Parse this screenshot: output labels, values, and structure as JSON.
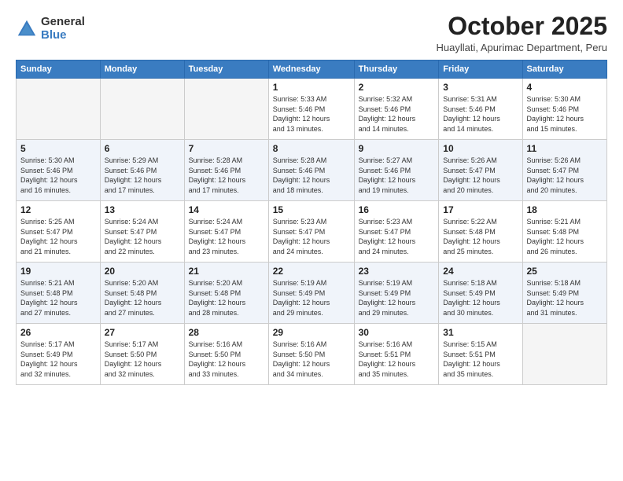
{
  "logo": {
    "general": "General",
    "blue": "Blue"
  },
  "header": {
    "month": "October 2025",
    "location": "Huayllati, Apurimac Department, Peru"
  },
  "weekdays": [
    "Sunday",
    "Monday",
    "Tuesday",
    "Wednesday",
    "Thursday",
    "Friday",
    "Saturday"
  ],
  "weeks": [
    [
      {
        "day": "",
        "info": ""
      },
      {
        "day": "",
        "info": ""
      },
      {
        "day": "",
        "info": ""
      },
      {
        "day": "1",
        "info": "Sunrise: 5:33 AM\nSunset: 5:46 PM\nDaylight: 12 hours\nand 13 minutes."
      },
      {
        "day": "2",
        "info": "Sunrise: 5:32 AM\nSunset: 5:46 PM\nDaylight: 12 hours\nand 14 minutes."
      },
      {
        "day": "3",
        "info": "Sunrise: 5:31 AM\nSunset: 5:46 PM\nDaylight: 12 hours\nand 14 minutes."
      },
      {
        "day": "4",
        "info": "Sunrise: 5:30 AM\nSunset: 5:46 PM\nDaylight: 12 hours\nand 15 minutes."
      }
    ],
    [
      {
        "day": "5",
        "info": "Sunrise: 5:30 AM\nSunset: 5:46 PM\nDaylight: 12 hours\nand 16 minutes."
      },
      {
        "day": "6",
        "info": "Sunrise: 5:29 AM\nSunset: 5:46 PM\nDaylight: 12 hours\nand 17 minutes."
      },
      {
        "day": "7",
        "info": "Sunrise: 5:28 AM\nSunset: 5:46 PM\nDaylight: 12 hours\nand 17 minutes."
      },
      {
        "day": "8",
        "info": "Sunrise: 5:28 AM\nSunset: 5:46 PM\nDaylight: 12 hours\nand 18 minutes."
      },
      {
        "day": "9",
        "info": "Sunrise: 5:27 AM\nSunset: 5:46 PM\nDaylight: 12 hours\nand 19 minutes."
      },
      {
        "day": "10",
        "info": "Sunrise: 5:26 AM\nSunset: 5:47 PM\nDaylight: 12 hours\nand 20 minutes."
      },
      {
        "day": "11",
        "info": "Sunrise: 5:26 AM\nSunset: 5:47 PM\nDaylight: 12 hours\nand 20 minutes."
      }
    ],
    [
      {
        "day": "12",
        "info": "Sunrise: 5:25 AM\nSunset: 5:47 PM\nDaylight: 12 hours\nand 21 minutes."
      },
      {
        "day": "13",
        "info": "Sunrise: 5:24 AM\nSunset: 5:47 PM\nDaylight: 12 hours\nand 22 minutes."
      },
      {
        "day": "14",
        "info": "Sunrise: 5:24 AM\nSunset: 5:47 PM\nDaylight: 12 hours\nand 23 minutes."
      },
      {
        "day": "15",
        "info": "Sunrise: 5:23 AM\nSunset: 5:47 PM\nDaylight: 12 hours\nand 24 minutes."
      },
      {
        "day": "16",
        "info": "Sunrise: 5:23 AM\nSunset: 5:47 PM\nDaylight: 12 hours\nand 24 minutes."
      },
      {
        "day": "17",
        "info": "Sunrise: 5:22 AM\nSunset: 5:48 PM\nDaylight: 12 hours\nand 25 minutes."
      },
      {
        "day": "18",
        "info": "Sunrise: 5:21 AM\nSunset: 5:48 PM\nDaylight: 12 hours\nand 26 minutes."
      }
    ],
    [
      {
        "day": "19",
        "info": "Sunrise: 5:21 AM\nSunset: 5:48 PM\nDaylight: 12 hours\nand 27 minutes."
      },
      {
        "day": "20",
        "info": "Sunrise: 5:20 AM\nSunset: 5:48 PM\nDaylight: 12 hours\nand 27 minutes."
      },
      {
        "day": "21",
        "info": "Sunrise: 5:20 AM\nSunset: 5:48 PM\nDaylight: 12 hours\nand 28 minutes."
      },
      {
        "day": "22",
        "info": "Sunrise: 5:19 AM\nSunset: 5:49 PM\nDaylight: 12 hours\nand 29 minutes."
      },
      {
        "day": "23",
        "info": "Sunrise: 5:19 AM\nSunset: 5:49 PM\nDaylight: 12 hours\nand 29 minutes."
      },
      {
        "day": "24",
        "info": "Sunrise: 5:18 AM\nSunset: 5:49 PM\nDaylight: 12 hours\nand 30 minutes."
      },
      {
        "day": "25",
        "info": "Sunrise: 5:18 AM\nSunset: 5:49 PM\nDaylight: 12 hours\nand 31 minutes."
      }
    ],
    [
      {
        "day": "26",
        "info": "Sunrise: 5:17 AM\nSunset: 5:49 PM\nDaylight: 12 hours\nand 32 minutes."
      },
      {
        "day": "27",
        "info": "Sunrise: 5:17 AM\nSunset: 5:50 PM\nDaylight: 12 hours\nand 32 minutes."
      },
      {
        "day": "28",
        "info": "Sunrise: 5:16 AM\nSunset: 5:50 PM\nDaylight: 12 hours\nand 33 minutes."
      },
      {
        "day": "29",
        "info": "Sunrise: 5:16 AM\nSunset: 5:50 PM\nDaylight: 12 hours\nand 34 minutes."
      },
      {
        "day": "30",
        "info": "Sunrise: 5:16 AM\nSunset: 5:51 PM\nDaylight: 12 hours\nand 35 minutes."
      },
      {
        "day": "31",
        "info": "Sunrise: 5:15 AM\nSunset: 5:51 PM\nDaylight: 12 hours\nand 35 minutes."
      },
      {
        "day": "",
        "info": ""
      }
    ]
  ]
}
